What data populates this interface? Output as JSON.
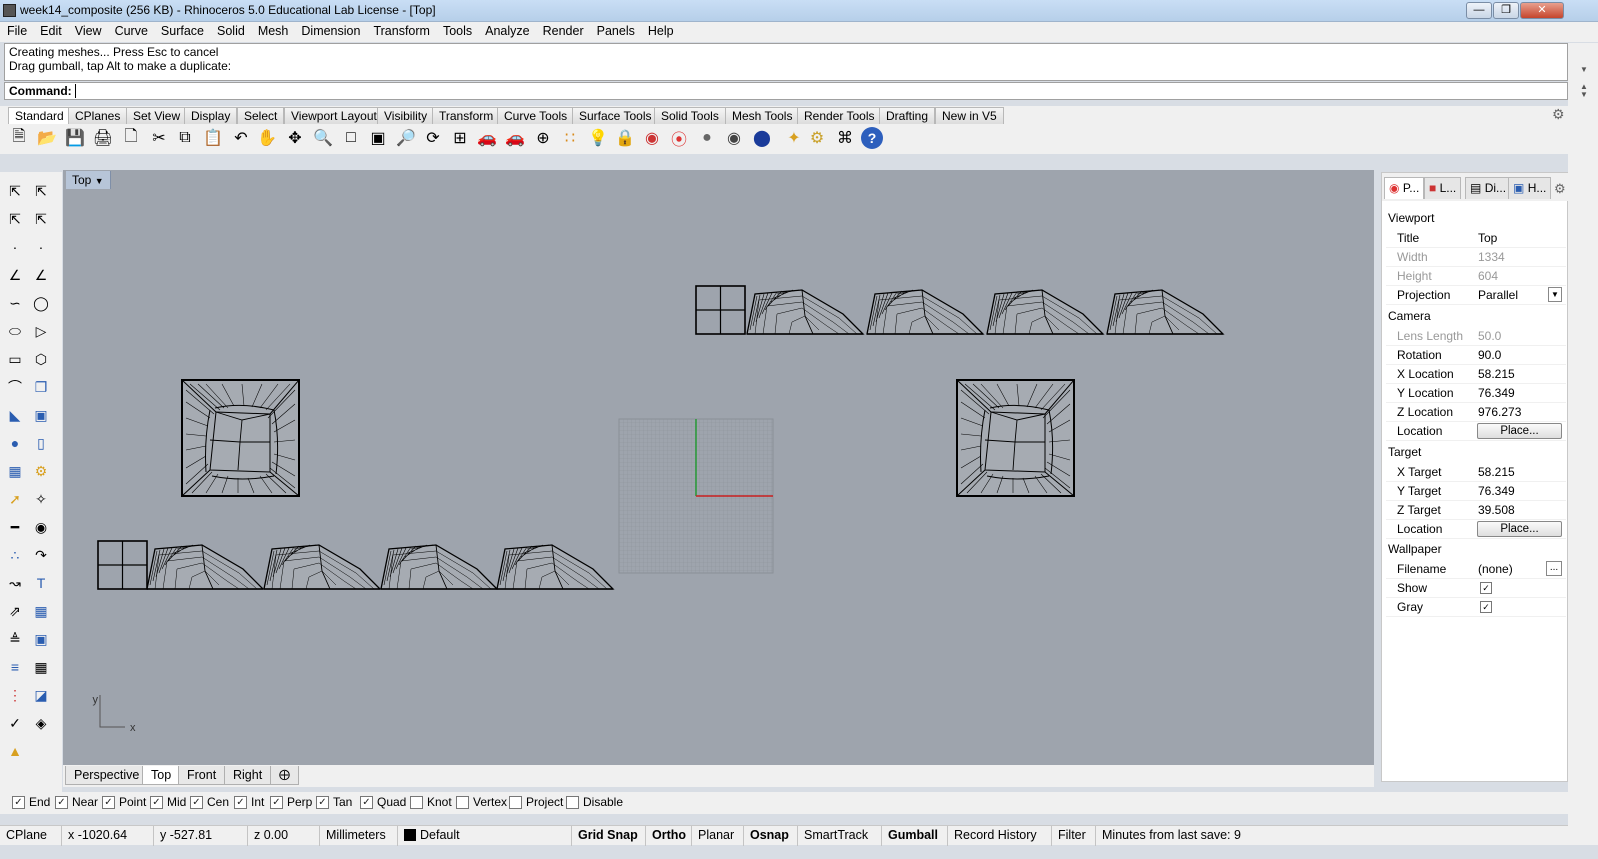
{
  "window": {
    "title": "week14_composite (256 KB) - Rhinoceros 5.0 Educational Lab License - [Top]"
  },
  "menu": [
    "File",
    "Edit",
    "View",
    "Curve",
    "Surface",
    "Solid",
    "Mesh",
    "Dimension",
    "Transform",
    "Tools",
    "Analyze",
    "Render",
    "Panels",
    "Help"
  ],
  "command": {
    "history_line1": "Creating meshes... Press Esc to cancel",
    "history_line2": "Drag gumball, tap Alt to make a duplicate:",
    "prompt": "Command:"
  },
  "toolbar_tabs": [
    "Standard",
    "CPlanes",
    "Set View",
    "Display",
    "Select",
    "Viewport Layout",
    "Visibility",
    "Transform",
    "Curve Tools",
    "Surface Tools",
    "Solid Tools",
    "Mesh Tools",
    "Render Tools",
    "Drafting",
    "New in V5"
  ],
  "viewport": {
    "title": "Top",
    "axis_x": "x",
    "axis_y": "y"
  },
  "viewport_tabs": [
    "Perspective",
    "Top",
    "Front",
    "Right"
  ],
  "osnaps": [
    {
      "label": "End",
      "checked": true
    },
    {
      "label": "Near",
      "checked": true
    },
    {
      "label": "Point",
      "checked": true
    },
    {
      "label": "Mid",
      "checked": true
    },
    {
      "label": "Cen",
      "checked": true
    },
    {
      "label": "Int",
      "checked": true
    },
    {
      "label": "Perp",
      "checked": true
    },
    {
      "label": "Tan",
      "checked": true
    },
    {
      "label": "Quad",
      "checked": true
    },
    {
      "label": "Knot",
      "checked": false
    },
    {
      "label": "Vertex",
      "checked": false
    },
    {
      "label": "Project",
      "checked": false
    },
    {
      "label": "Disable",
      "checked": false
    }
  ],
  "status": {
    "cplane": "CPlane",
    "x": "x -1020.64",
    "y": "y -527.81",
    "z": "z 0.00",
    "units": "Millimeters",
    "layer": "Default",
    "grid_snap": "Grid Snap",
    "ortho": "Ortho",
    "planar": "Planar",
    "osnap": "Osnap",
    "smarttrack": "SmartTrack",
    "gumball": "Gumball",
    "record_history": "Record History",
    "filter": "Filter",
    "last_save": "Minutes from last save: 9"
  },
  "panel": {
    "tabs": [
      "P...",
      "L...",
      "Di...",
      "H..."
    ],
    "sections": {
      "viewport": "Viewport",
      "camera": "Camera",
      "target": "Target",
      "wallpaper": "Wallpaper"
    },
    "viewport_rows": [
      {
        "key": "Title",
        "value": "Top"
      },
      {
        "key": "Width",
        "value": "1334"
      },
      {
        "key": "Height",
        "value": "604"
      },
      {
        "key": "Projection",
        "value": "Parallel"
      }
    ],
    "camera_rows": [
      {
        "key": "Lens Length",
        "value": "50.0"
      },
      {
        "key": "Rotation",
        "value": "90.0"
      },
      {
        "key": "X Location",
        "value": "58.215"
      },
      {
        "key": "Y Location",
        "value": "76.349"
      },
      {
        "key": "Z Location",
        "value": "976.273"
      },
      {
        "key": "Location",
        "value": "Place..."
      }
    ],
    "target_rows": [
      {
        "key": "X Target",
        "value": "58.215"
      },
      {
        "key": "Y Target",
        "value": "76.349"
      },
      {
        "key": "Z Target",
        "value": "39.508"
      },
      {
        "key": "Location",
        "value": "Place..."
      }
    ],
    "wallpaper_rows": [
      {
        "key": "Filename",
        "value": "(none)"
      },
      {
        "key": "Show",
        "value": "checked"
      },
      {
        "key": "Gray",
        "value": "checked"
      }
    ],
    "browse": "..."
  }
}
